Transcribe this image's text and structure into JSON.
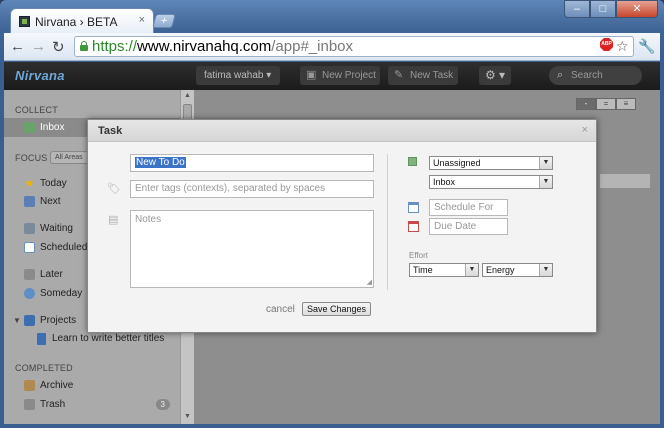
{
  "browser": {
    "tab_title": "Nirvana › BETA",
    "tab_close": "×",
    "new_tab": "+",
    "url": {
      "scheme": "https://",
      "host": "www.nirvanahq.com",
      "path": "/app#_inbox"
    },
    "win_min": "‒",
    "win_max": "□",
    "win_close": "✕",
    "back": "←",
    "forward": "→",
    "reload": "↻",
    "abp": "ABP",
    "star": "☆",
    "wrench": "🔧"
  },
  "app": {
    "logo": "Nirvana",
    "user": "fatima wahab ▾",
    "new_project": "New Project",
    "new_task": "New Task",
    "gear": "⚙ ▾",
    "search_placeholder": "Search"
  },
  "sidebar": {
    "collect_header": "COLLECT",
    "inbox": "Inbox",
    "focus_header": "FOCUS",
    "areas_button": "All Areas",
    "today": "Today",
    "next": "Next",
    "waiting": "Waiting",
    "scheduled": "Scheduled",
    "later": "Later",
    "someday": "Someday",
    "projects": "Projects",
    "project_child": "Learn to write better titles",
    "completed_header": "COMPLETED",
    "archive": "Archive",
    "trash": "Trash",
    "trash_count": "3"
  },
  "view_toggle": [
    "-",
    "=",
    "≡"
  ],
  "dialog": {
    "title": "Task",
    "close": "×",
    "task_name": "New To Do",
    "tags_placeholder": "Enter tags (contexts), separated by spaces",
    "notes_placeholder": "Notes",
    "status_value": "Unassigned",
    "list_value": "Inbox",
    "schedule_placeholder": "Schedule For",
    "due_placeholder": "Due Date",
    "effort_label": "Effort",
    "time_value": "Time",
    "energy_value": "Energy",
    "cancel_label": "cancel",
    "save_label": "Save Changes"
  },
  "colors": {
    "accent": "#3b73c8",
    "header_bg": "#1b1b1b",
    "sidebar_bg": "#aaaaaa",
    "dialog_bg": "#f3f3f3"
  }
}
